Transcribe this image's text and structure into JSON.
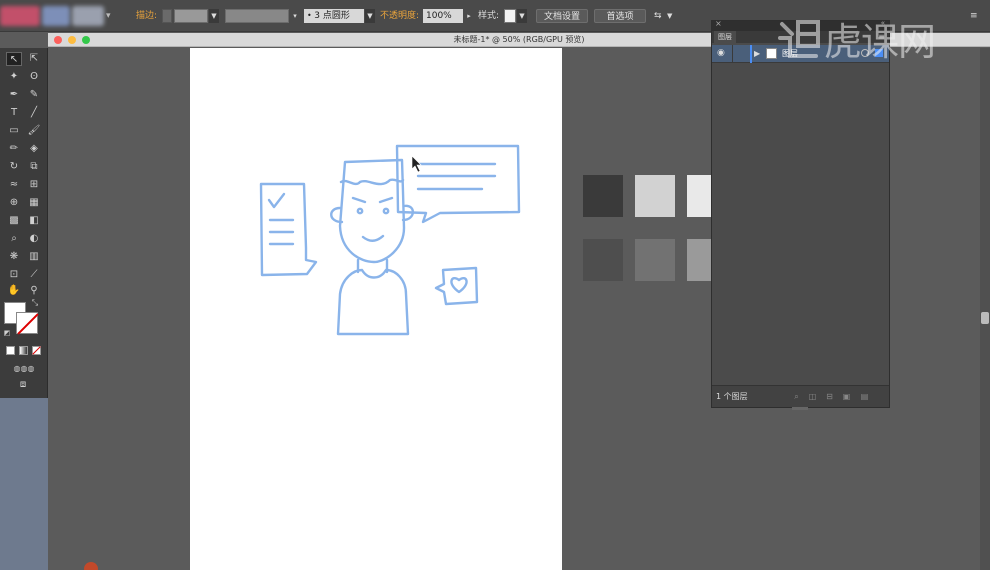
{
  "control_bar": {
    "stroke_label": "描边:",
    "brush_value": "3 点圆形",
    "opacity_label": "不透明度:",
    "opacity_value": "100%",
    "style_label": "样式:",
    "doc_setup_button": "文档设置",
    "preferences_button": "首选项"
  },
  "document": {
    "title": "未标题-1* @ 50% (RGB/GPU 预览)"
  },
  "layers_panel": {
    "tab_label": "图层",
    "layer_name": "图层",
    "footer_count": "1 个图层"
  },
  "watermark": {
    "text": "虎课网"
  },
  "colors": {
    "sketch_blue": "#8ab4ea",
    "swatches": [
      "#3a3a3a",
      "#d2d2d2",
      "#e9e9e9",
      "#4e4e4e",
      "#727272",
      "#9a9a9a"
    ]
  }
}
